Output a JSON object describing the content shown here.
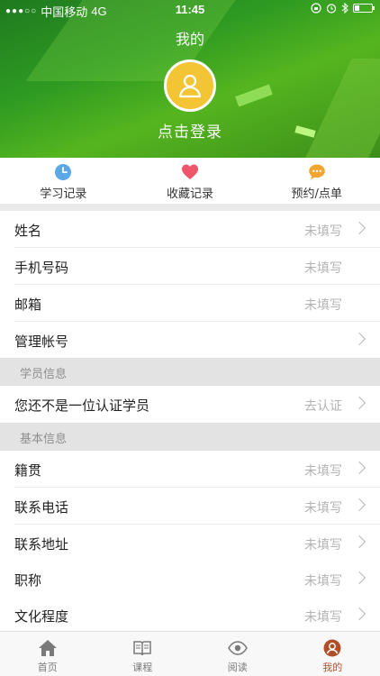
{
  "status_bar": {
    "signal_dots": "●●●○○",
    "carrier": "中国移动",
    "network": "4G",
    "time": "11:45",
    "icons": [
      "lock-rotation-icon",
      "alarm-icon",
      "bluetooth-icon"
    ],
    "battery_level": 0.25
  },
  "header": {
    "title": "我的",
    "login_text": "点击登录",
    "avatar_icon": "user-icon",
    "colors": {
      "green": "#2e9a22",
      "avatar": "#f3c434"
    }
  },
  "quick_actions": [
    {
      "label": "学习记录",
      "icon": "clock-icon",
      "color": "#5aa9e6"
    },
    {
      "label": "收藏记录",
      "icon": "heart-icon",
      "color": "#f0566b"
    },
    {
      "label": "预约/点单",
      "icon": "chat-icon",
      "color": "#f4a531"
    }
  ],
  "profile_rows": [
    {
      "label": "姓名",
      "value": "未填写",
      "arrow": true
    },
    {
      "label": "手机号码",
      "value": "未填写",
      "arrow": false
    },
    {
      "label": "邮箱",
      "value": "未填写",
      "arrow": false
    },
    {
      "label": "管理帐号",
      "value": "",
      "arrow": true
    }
  ],
  "student_section": {
    "title": "学员信息",
    "row": {
      "label": "您还不是一位认证学员",
      "value": "去认证",
      "arrow": true
    }
  },
  "basic_section": {
    "title": "基本信息",
    "rows": [
      {
        "label": "籍贯",
        "value": "未填写",
        "arrow": true
      },
      {
        "label": "联系电话",
        "value": "未填写",
        "arrow": true
      },
      {
        "label": "联系地址",
        "value": "未填写",
        "arrow": true
      },
      {
        "label": "职称",
        "value": "未填写",
        "arrow": true
      },
      {
        "label": "文化程度",
        "value": "未填写",
        "arrow": true
      }
    ]
  },
  "tabbar": {
    "active_color": "#b0502a",
    "tabs": [
      {
        "label": "首页",
        "icon": "home-icon",
        "active": false
      },
      {
        "label": "课程",
        "icon": "book-icon",
        "active": false
      },
      {
        "label": "阅读",
        "icon": "eye-icon",
        "active": false
      },
      {
        "label": "我的",
        "icon": "profile-icon",
        "active": true
      }
    ]
  }
}
